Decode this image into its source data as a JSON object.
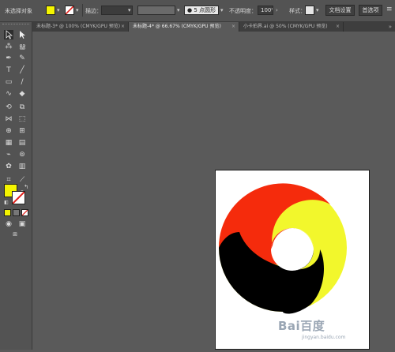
{
  "control_bar": {
    "selection_label": "未选择对象",
    "fill_color": "#f5f500",
    "stroke_label": "描边：",
    "stroke_value": "",
    "point_label": "5 点圆形",
    "opacity_label": "不透明度：",
    "opacity_value": "100%",
    "style_label": "样式：",
    "doc_settings_label": "文档设置",
    "preferences_label": "首选项"
  },
  "tabs": [
    {
      "label": "未标题-3* @ 100% (CMYK/GPU 预览)",
      "active": false
    },
    {
      "label": "未标题-4* @ 66.67% (CMYK/GPU 预览)",
      "active": true
    },
    {
      "label": "小卡拍界.ai @ 50% (CMYK/GPU 预览)",
      "active": false
    }
  ],
  "toolbar": {
    "fill_color": "#f5f500",
    "tools": [
      "selection",
      "direct-selection",
      "magic-wand",
      "lasso",
      "pen",
      "curvature",
      "type",
      "line",
      "rectangle",
      "paintbrush",
      "shaper",
      "eraser",
      "rotate",
      "scale",
      "width",
      "free-transform",
      "shape-builder",
      "perspective",
      "mesh",
      "gradient",
      "eyedropper",
      "blend",
      "symbol-sprayer",
      "column-graph",
      "artboard",
      "slice",
      "hand",
      "zoom"
    ]
  },
  "artwork": {
    "red": "#f52b0c",
    "yellow": "#f2f72c",
    "black": "#000000"
  },
  "watermark": {
    "text": "Bai百度",
    "sub": "jingyan.baidu.com"
  }
}
